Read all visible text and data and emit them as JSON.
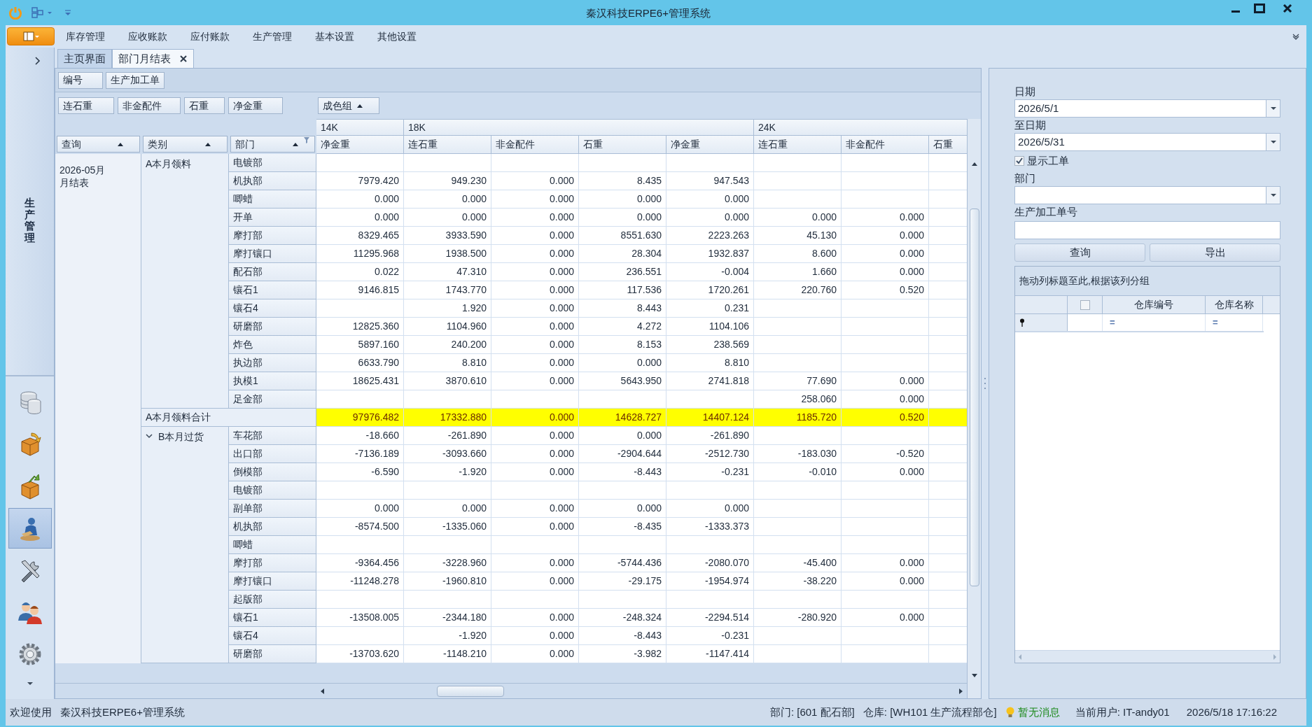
{
  "window": {
    "title": "秦汉科技ERPE6+管理系统"
  },
  "menu": [
    "库存管理",
    "应收账款",
    "应付账款",
    "生产管理",
    "基本设置",
    "其他设置"
  ],
  "nav": {
    "title": "生产管理",
    "items": [
      {
        "kind": "database",
        "selected": false
      },
      {
        "kind": "import",
        "selected": false
      },
      {
        "kind": "export",
        "selected": false
      },
      {
        "kind": "worker",
        "selected": true
      },
      {
        "kind": "tools",
        "selected": false
      },
      {
        "kind": "users",
        "selected": false
      },
      {
        "kind": "settings",
        "selected": false
      }
    ]
  },
  "tabs": [
    {
      "label": "主页界面",
      "selected": false,
      "closable": false
    },
    {
      "label": "部门月结表",
      "selected": true,
      "closable": true
    }
  ],
  "pivot": {
    "filter_fields": [
      "编号",
      "生产加工单"
    ],
    "data_fields": [
      "连石重",
      "非金配件",
      "石重",
      "净金重"
    ],
    "column_field": {
      "label": "成色组",
      "sort_ascending": true
    },
    "row_fields": [
      {
        "label": "查询",
        "sort_ascending": true,
        "filter": false
      },
      {
        "label": "类别",
        "sort_ascending": true,
        "filter": false
      },
      {
        "label": "部门",
        "sort_ascending": true,
        "filter": true
      }
    ],
    "column_groups": [
      {
        "label": "14K",
        "columns": [
          "净金重"
        ]
      },
      {
        "label": "18K",
        "columns": [
          "连石重",
          "非金配件",
          "石重",
          "净金重"
        ]
      },
      {
        "label": "24K",
        "columns": [
          "连石重",
          "非金配件",
          "石重"
        ]
      }
    ],
    "period": [
      "2026-05月",
      "月结表"
    ],
    "sections": [
      {
        "kind": "group",
        "label": "A本月领料",
        "rows": [
          {
            "dept": "电镀部"
          },
          {
            "dept": "机执部",
            "group_1": [
              "7979.420"
            ],
            "group_2": [
              "949.230",
              "0.000",
              "8.435",
              "947.543"
            ]
          },
          {
            "dept": "唧蜡",
            "group_1": [
              "0.000"
            ],
            "group_2": [
              "0.000",
              "0.000",
              "0.000",
              "0.000"
            ]
          },
          {
            "dept": "开单",
            "group_1": [
              "0.000"
            ],
            "group_2": [
              "0.000",
              "0.000",
              "0.000",
              "0.000"
            ],
            "group_3": [
              "0.000",
              "0.000"
            ]
          },
          {
            "dept": "摩打部",
            "group_1": [
              "8329.465"
            ],
            "group_2": [
              "3933.590",
              "0.000",
              "8551.630",
              "2223.263"
            ],
            "group_3": [
              "45.130",
              "0.000"
            ]
          },
          {
            "dept": "摩打镶口",
            "group_1": [
              "11295.968"
            ],
            "group_2": [
              "1938.500",
              "0.000",
              "28.304",
              "1932.837"
            ],
            "group_3": [
              "8.600",
              "0.000"
            ]
          },
          {
            "dept": "配石部",
            "group_1": [
              "0.022"
            ],
            "group_2": [
              "47.310",
              "0.000",
              "236.551",
              "-0.004"
            ],
            "group_3": [
              "1.660",
              "0.000"
            ]
          },
          {
            "dept": "镶石1",
            "group_1": [
              "9146.815"
            ],
            "group_2": [
              "1743.770",
              "0.000",
              "117.536",
              "1720.261"
            ],
            "group_3": [
              "220.760",
              "0.520"
            ]
          },
          {
            "dept": "镶石4",
            "group_2": [
              "1.920",
              "0.000",
              "8.443",
              "0.231"
            ]
          },
          {
            "dept": "研磨部",
            "group_1": [
              "12825.360"
            ],
            "group_2": [
              "1104.960",
              "0.000",
              "4.272",
              "1104.106"
            ]
          },
          {
            "dept": "炸色",
            "group_1": [
              "5897.160"
            ],
            "group_2": [
              "240.200",
              "0.000",
              "8.153",
              "238.569"
            ]
          },
          {
            "dept": "执边部",
            "group_1": [
              "6633.790"
            ],
            "group_2": [
              "8.810",
              "0.000",
              "0.000",
              "8.810"
            ]
          },
          {
            "dept": "执模1",
            "group_1": [
              "18625.431"
            ],
            "group_2": [
              "3870.610",
              "0.000",
              "5643.950",
              "2741.818"
            ],
            "group_3": [
              "77.690",
              "0.000"
            ]
          },
          {
            "dept": "足金部",
            "group_3": [
              "258.060",
              "0.000"
            ]
          }
        ]
      },
      {
        "kind": "total",
        "label": "A本月领料合计",
        "group_1": [
          "97976.482"
        ],
        "group_2": [
          "17332.880",
          "0.000",
          "14628.727",
          "14407.124"
        ],
        "group_3": [
          "1185.720",
          "0.520"
        ]
      },
      {
        "kind": "group",
        "label": "B本月过货",
        "expanded": true,
        "rows": [
          {
            "dept": "车花部",
            "group_1": [
              "-18.660"
            ],
            "group_2": [
              "-261.890",
              "0.000",
              "0.000",
              "-261.890"
            ]
          },
          {
            "dept": "出口部",
            "group_1": [
              "-7136.189"
            ],
            "group_2": [
              "-3093.660",
              "0.000",
              "-2904.644",
              "-2512.730"
            ],
            "group_3": [
              "-183.030",
              "-0.520"
            ]
          },
          {
            "dept": "倒模部",
            "group_1": [
              "-6.590"
            ],
            "group_2": [
              "-1.920",
              "0.000",
              "-8.443",
              "-0.231"
            ],
            "group_3": [
              "-0.010",
              "0.000"
            ]
          },
          {
            "dept": "电镀部"
          },
          {
            "dept": "副单部",
            "group_1": [
              "0.000"
            ],
            "group_2": [
              "0.000",
              "0.000",
              "0.000",
              "0.000"
            ]
          },
          {
            "dept": "机执部",
            "group_1": [
              "-8574.500"
            ],
            "group_2": [
              "-1335.060",
              "0.000",
              "-8.435",
              "-1333.373"
            ]
          },
          {
            "dept": "唧蜡"
          },
          {
            "dept": "摩打部",
            "group_1": [
              "-9364.456"
            ],
            "group_2": [
              "-3228.960",
              "0.000",
              "-5744.436",
              "-2080.070"
            ],
            "group_3": [
              "-45.400",
              "0.000"
            ]
          },
          {
            "dept": "摩打镶口",
            "group_1": [
              "-11248.278"
            ],
            "group_2": [
              "-1960.810",
              "0.000",
              "-29.175",
              "-1954.974"
            ],
            "group_3": [
              "-38.220",
              "0.000"
            ]
          },
          {
            "dept": "起版部"
          },
          {
            "dept": "镶石1",
            "group_1": [
              "-13508.005"
            ],
            "group_2": [
              "-2344.180",
              "0.000",
              "-248.324",
              "-2294.514"
            ],
            "group_3": [
              "-280.920",
              "0.000"
            ]
          },
          {
            "dept": "镶石4",
            "group_2": [
              "-1.920",
              "0.000",
              "-8.443",
              "-0.231"
            ]
          },
          {
            "dept": "研磨部",
            "group_1": [
              "-13703.620"
            ],
            "group_2": [
              "-1148.210",
              "0.000",
              "-3.982",
              "-1147.414"
            ]
          }
        ]
      }
    ]
  },
  "filters": {
    "date_from": {
      "label": "日期",
      "value": "2026/5/1"
    },
    "date_to": {
      "label": "至日期",
      "value": "2026/5/31"
    },
    "show_orders": {
      "label": "显示工单",
      "checked": true
    },
    "department": {
      "label": "部门"
    },
    "order_no": {
      "label": "生产加工单号"
    },
    "buttons": [
      "查询",
      "导出"
    ]
  },
  "warehouse_grid": {
    "group_hint": "拖动列标题至此,根据该列分组",
    "select_all": {
      "checked": false
    },
    "columns": [
      "仓库编号",
      "仓库名称"
    ],
    "filter_operators": [
      "=",
      "="
    ]
  },
  "status_bar": {
    "welcome": "欢迎使用",
    "app": "秦汉科技ERPE6+管理系统",
    "department": "部门: [601 配石部]",
    "warehouse": "仓库: [WH101 生产流程部仓]",
    "message": "暂无消息",
    "user": "当前用户: IT-andy01",
    "datetime": "2026/5/18 17:16:22"
  }
}
